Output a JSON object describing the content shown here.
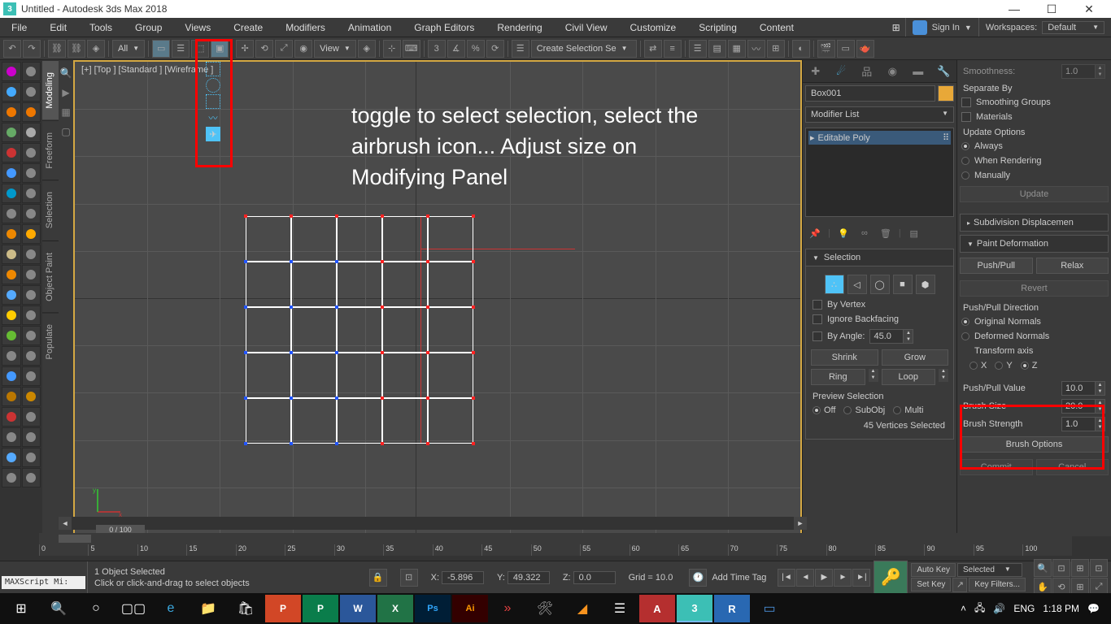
{
  "titlebar": {
    "title": "Untitled - Autodesk 3ds Max 2018"
  },
  "menu": [
    "File",
    "Edit",
    "Tools",
    "Group",
    "Views",
    "Create",
    "Modifiers",
    "Animation",
    "Graph Editors",
    "Rendering",
    "Civil View",
    "Customize",
    "Scripting",
    "Content"
  ],
  "signin": {
    "label": "Sign In"
  },
  "workspace": {
    "label": "Workspaces:",
    "value": "Default"
  },
  "toolbar": {
    "all": "All",
    "view": "View",
    "create_sel": "Create Selection Se"
  },
  "vtabs": [
    "Modeling",
    "Freeform",
    "Selection",
    "Object Paint",
    "Populate"
  ],
  "viewport": {
    "label": "[+] [Top ] [Standard ] [Wireframe ]"
  },
  "annotation": {
    "line1": "toggle to select selection, select the",
    "line2": "airbrush icon... Adjust size on",
    "line3": "Modifying Panel"
  },
  "cmd": {
    "obj_name": "Box001",
    "mod_list": "Modifier List",
    "mod_item": "Editable Poly"
  },
  "selection": {
    "header": "Selection",
    "by_vertex": "By Vertex",
    "ignore_backfacing": "Ignore Backfacing",
    "by_angle": "By Angle:",
    "angle_val": "45.0",
    "shrink": "Shrink",
    "grow": "Grow",
    "ring": "Ring",
    "loop": "Loop",
    "preview": "Preview Selection",
    "off": "Off",
    "subobj": "SubObj",
    "multi": "Multi",
    "count": "45 Vertices Selected"
  },
  "paint": {
    "smoothness": "Smoothness:",
    "smoothness_val": "1.0",
    "separate_by": "Separate By",
    "smoothing_groups": "Smoothing Groups",
    "materials": "Materials",
    "update_options": "Update Options",
    "always": "Always",
    "when_rendering": "When Rendering",
    "manually": "Manually",
    "update_btn": "Update",
    "subdiv_hdr": "Subdivision Displacemen",
    "paint_def_hdr": "Paint Deformation",
    "push_pull": "Push/Pull",
    "relax": "Relax",
    "revert": "Revert",
    "pp_dir": "Push/Pull Direction",
    "orig_normals": "Original Normals",
    "deformed_normals": "Deformed Normals",
    "transform_axis": "Transform axis",
    "x": "X",
    "y": "Y",
    "z": "Z",
    "pp_value": "Push/Pull Value",
    "pp_value_v": "10.0",
    "brush_size": "Brush Size",
    "brush_size_v": "20.0",
    "brush_strength": "Brush Strength",
    "brush_strength_v": "1.0",
    "brush_options": "Brush Options",
    "commit": "Commit",
    "cancel": "Cancel"
  },
  "hscroll": {
    "label": "0 / 100"
  },
  "timeline_ticks": [
    "0",
    "5",
    "10",
    "15",
    "20",
    "25",
    "30",
    "35",
    "40",
    "45",
    "50",
    "55",
    "60",
    "65",
    "70",
    "75",
    "80",
    "85",
    "90",
    "95",
    "100"
  ],
  "status": {
    "maxscript": "MAXScript Mi:",
    "obj_sel": "1 Object Selected",
    "hint": "Click or click-and-drag to select objects",
    "x": "X:",
    "xv": "-5.896",
    "y": "Y:",
    "yv": "49.322",
    "z": "Z:",
    "zv": "0.0",
    "grid": "Grid = 10.0",
    "add_time_tag": "Add Time Tag",
    "auto_key": "Auto Key",
    "set_key": "Set Key",
    "selected": "Selected",
    "key_filters": "Key Filters..."
  },
  "taskbar": {
    "lang": "ENG",
    "time": "1:18 PM"
  }
}
